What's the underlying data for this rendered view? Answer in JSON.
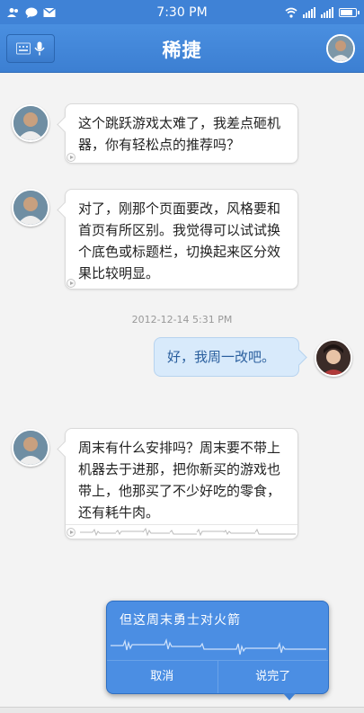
{
  "status_bar": {
    "time": "7:30 PM"
  },
  "header": {
    "title": "稀捷"
  },
  "messages": [
    {
      "text": "这个跳跃游戏太难了，我差点砸机器，你有轻松点的推荐吗？"
    },
    {
      "text": "对了，刚那个页面要改，风格要和首页有所区别。我觉得可以试试换个底色或标题栏，切换起来区分效果比较明显。"
    },
    {
      "text": "好，我周一改吧。"
    },
    {
      "text": "周末有什么安排吗？周末要不带上机器去于进那，把你新买的游戏也带上，他那买了不少好吃的零食，还有耗牛肉。"
    }
  ],
  "timestamp": "2012-12-14 5:31 PM",
  "voice_popup": {
    "recognized_text": "但这周末勇士对火箭",
    "cancel_label": "取消",
    "done_label": "说完了"
  },
  "colors": {
    "header": "#3f82d6",
    "bubble_out": "#d8eafb",
    "popup": "#4b8ee3"
  }
}
